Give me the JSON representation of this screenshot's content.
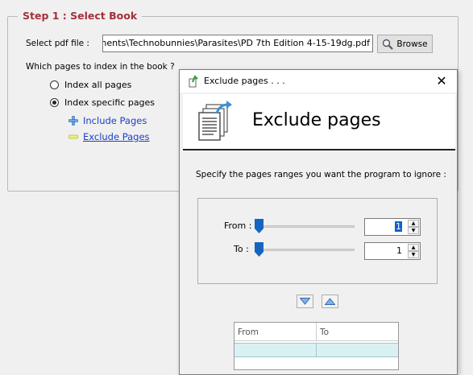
{
  "step": {
    "title": "Step 1 : Select Book",
    "pdf_label": "Select pdf file :",
    "pdf_value": "ments\\Technobunnies\\Parasites\\PD 7th Edition 4-15-19dg.pdf",
    "browse_label": "Browse",
    "which_pages_label": "Which pages to index in the book ?",
    "options": [
      {
        "label": "Index all pages",
        "checked": false
      },
      {
        "label": "Index specific pages",
        "checked": true
      }
    ],
    "include_label": "Include Pages",
    "exclude_label": "Exclude Pages"
  },
  "dialog": {
    "title": "Exclude pages . . .",
    "close_glyph": "✕",
    "banner_title": "Exclude pages",
    "instructions": "Specify the pages ranges you want the program to ignore :",
    "from_label": "From :",
    "to_label": "To :",
    "from_value": "1",
    "to_value": "1",
    "grid_columns": [
      "From",
      "To"
    ]
  },
  "colors": {
    "step_title": "#a3313c",
    "link": "#1a3fc8",
    "slider_thumb": "#1565c0",
    "selection": "#0a63c9",
    "grid_row": "#daf1f3"
  }
}
